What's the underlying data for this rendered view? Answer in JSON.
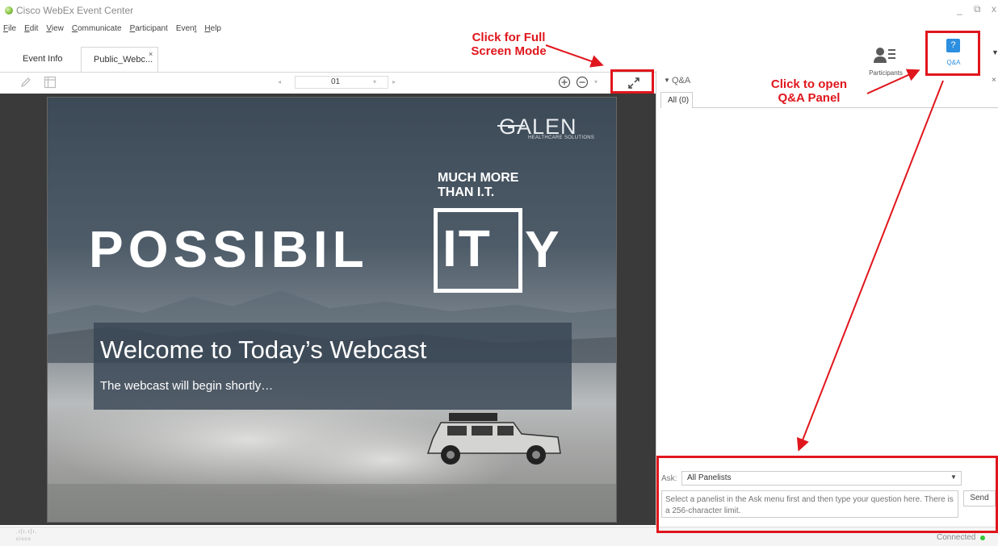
{
  "window": {
    "title": "Cisco WebEx Event Center",
    "controls": [
      "_",
      "⧉",
      "x"
    ]
  },
  "menu": [
    {
      "label": "File",
      "ul": "F",
      "rest": "ile"
    },
    {
      "label": "Edit",
      "ul": "E",
      "rest": "dit"
    },
    {
      "label": "View",
      "ul": "V",
      "rest": "iew"
    },
    {
      "label": "Communicate",
      "ul": "C",
      "rest": "ommunicate"
    },
    {
      "label": "Participant",
      "ul": "P",
      "rest": "articipant"
    },
    {
      "label": "Event",
      "pre": "Even",
      "ul": "t",
      "rest": ""
    },
    {
      "label": "Help",
      "ul": "H",
      "rest": "elp"
    }
  ],
  "tabs": [
    {
      "label": "Event Info"
    },
    {
      "label": "Public_Webc...",
      "close": "×"
    }
  ],
  "panel_buttons": {
    "participants": "Participants",
    "qa": "Q&A",
    "qa_icon_glyph": "?"
  },
  "viewer": {
    "page_number": "01"
  },
  "slide": {
    "logo": "GALEN",
    "logo_sub": "HEALTHCARE SOLUTIONS",
    "tagline_1": "MUCH MORE",
    "tagline_2": "THAN I.T.",
    "big_1": "POSSIBIL",
    "big_2": "IT",
    "big_3": "Y",
    "welcome_title": "Welcome to Today’s Webcast",
    "welcome_sub": "The webcast will begin shortly…"
  },
  "qa_panel": {
    "header": "Q&A",
    "tab_all": "All (0)",
    "ask_label": "Ask:",
    "ask_value": "All Panelists",
    "question_placeholder": "Select a panelist in the Ask menu first and then type your question here. There is a 256-character limit.",
    "send": "Send"
  },
  "status": {
    "connection": "Connected",
    "connection_color": "#35c436",
    "cisco": "cisco"
  },
  "annotations": {
    "fullscreen": "Click for Full Screen Mode",
    "fullscreen_line1": "Click for Full",
    "fullscreen_line2": "Screen Mode",
    "qa_open_line1": "Click to open",
    "qa_open_line2": "Q&A Panel",
    "accent": "#e0161d"
  }
}
